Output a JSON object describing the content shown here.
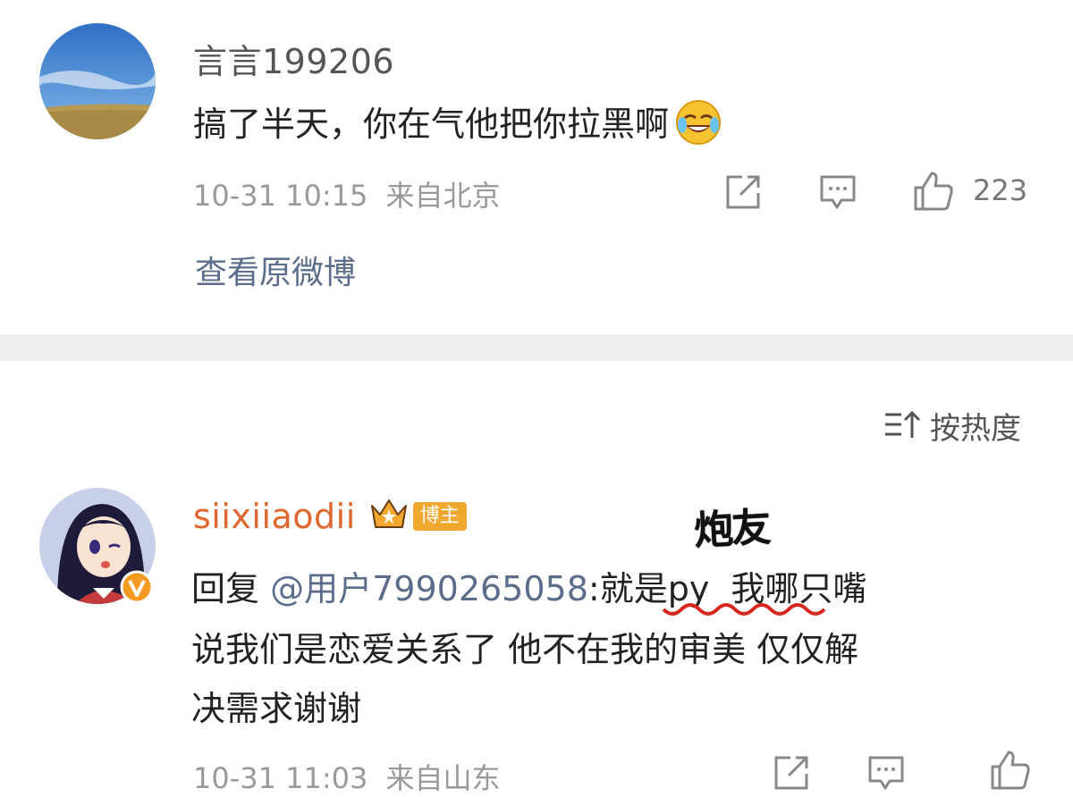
{
  "comment1": {
    "username": "言言199206",
    "text": "搞了半天，你在气他把你拉黑啊",
    "time": "10-31 10:15",
    "location": "来自北京",
    "likes": "223",
    "view_original": "查看原微博"
  },
  "sort": {
    "label": "按热度"
  },
  "comment2": {
    "username": "siixiiaodii",
    "badge": "博主",
    "reply_prefix": "回复",
    "mention": "@用户7990265058",
    "reply_part1": ":就是py",
    "reply_part2": "我哪只嘴",
    "line2": "说我们是恋爱关系了 他不在我的审美 仅仅解",
    "line3": "决需求谢谢",
    "time": "10-31 11:03",
    "location": "来自山东"
  },
  "annotation": {
    "text": "炮友",
    "underline_color": "#d9261c"
  },
  "colors": {
    "link": "#5b6d8a",
    "gold_badge": "#f0a82e",
    "verified": "#f59a23"
  }
}
